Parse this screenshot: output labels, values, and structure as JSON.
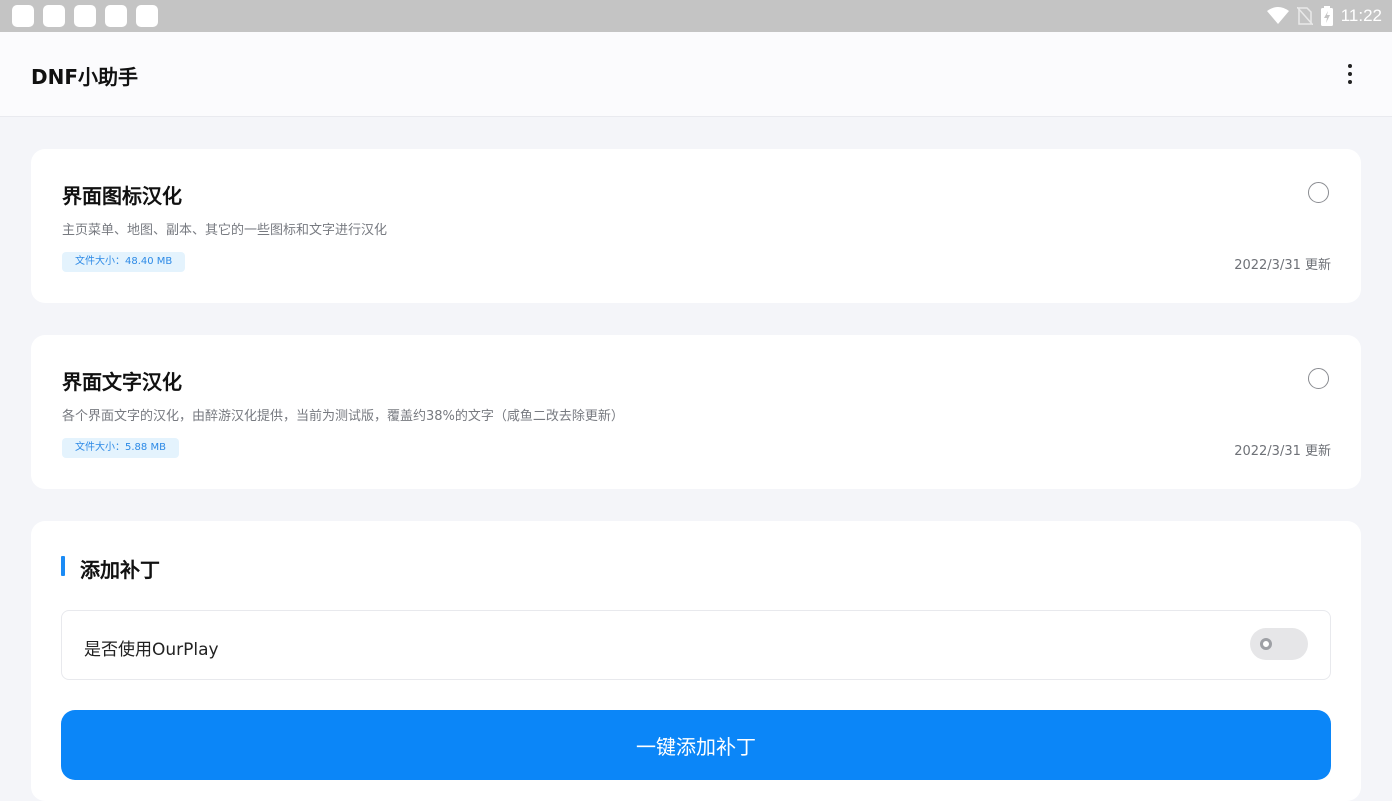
{
  "status_bar": {
    "time": "11:22",
    "icons": [
      "wifi-icon",
      "no-sim-icon",
      "battery-charging-icon"
    ]
  },
  "app_bar": {
    "title": "DNF小助手",
    "menu_icon": "more-vert-icon"
  },
  "patches": [
    {
      "title": "界面图标汉化",
      "description": "主页菜单、地图、副本、其它的一些图标和文字进行汉化",
      "size": "文件大小：48.40 MB",
      "updated": "2022/3/31 更新",
      "selected": false
    },
    {
      "title": "界面文字汉化",
      "description": "各个界面文字的汉化，由醉游汉化提供，当前为测试版，覆盖约38%的文字（咸鱼二改去除更新）",
      "size": "文件大小：5.88 MB",
      "updated": "2022/3/31 更新",
      "selected": false
    }
  ],
  "add_patch": {
    "section_title": "添加补丁",
    "ourplay_label": "是否使用OurPlay",
    "ourplay_enabled": false,
    "button_label": "一键添加补丁"
  },
  "colors": {
    "accent": "#0b86f8",
    "badge_bg": "#e4f3fd",
    "badge_text": "#2d8ae6",
    "page_bg": "#f4f5f9"
  }
}
